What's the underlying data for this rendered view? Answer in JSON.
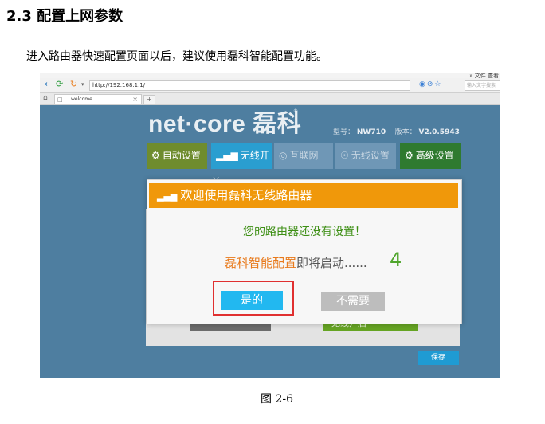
{
  "heading": "2.3 配置上网参数",
  "intro": "进入路由器快速配置页面以后，建议使用磊科智能配置功能。",
  "caption": "图 2-6",
  "browser": {
    "menu": "»  文件  查看",
    "url": "http://192.168.1.1/",
    "search_placeholder": "输入文字搜索",
    "tab_title": "welcome",
    "tab_close": "×",
    "new_tab": "+",
    "back_icon": "arrow-left",
    "forward_icon": "arrow-right",
    "reload_icon": "reload",
    "home_icon": "home"
  },
  "router": {
    "logo": "net·core 磊科",
    "logo_mark": "®",
    "model_label": "型号：",
    "model": "NW710",
    "version_label": "版本：",
    "version": "V2.0.5943",
    "nav": [
      {
        "label": "自动设置",
        "icon": "gear"
      },
      {
        "label": "无线开关",
        "icon": "signal-bars"
      },
      {
        "label": "互联网",
        "icon": "globe"
      },
      {
        "label": "无线设置",
        "icon": "wireless"
      },
      {
        "label": "高级设置",
        "icon": "gear"
      }
    ],
    "bg_button2": "无线开启",
    "save_button": "保存"
  },
  "dialog": {
    "title": "欢迎使用磊科无线路由器",
    "message1": "您的路由器还没有设置！",
    "message2_highlight": "磊科智能配置",
    "message2_rest": "即将启动......",
    "countdown": "4",
    "yes_button": "是的",
    "no_button": "不需要"
  },
  "colors": {
    "page_bg": "#4e7ea0",
    "dialog_header": "#f0980a",
    "yes_button": "#22b8f0",
    "highlight_box": "#e03030"
  }
}
